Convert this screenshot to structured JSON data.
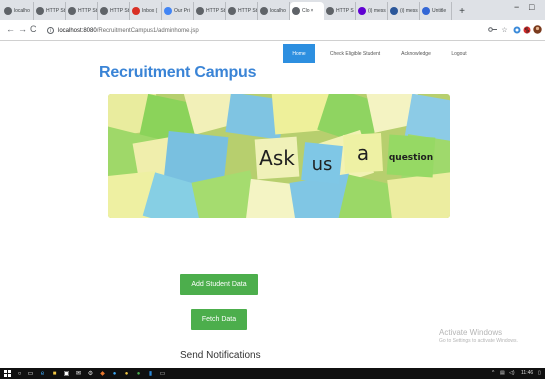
{
  "browser": {
    "tabs": [
      {
        "label": "localho",
        "color": "#5f6368",
        "glyph": "icon-chrome"
      },
      {
        "label": "HTTP St",
        "color": "#5f6368",
        "glyph": "icon-chrome"
      },
      {
        "label": "HTTP St",
        "color": "#5f6368",
        "glyph": "icon-chrome"
      },
      {
        "label": "HTTP St",
        "color": "#5f6368",
        "glyph": "icon-chrome"
      },
      {
        "label": "Inbox (",
        "color": "#d93025",
        "glyph": "gmail-icon"
      },
      {
        "label": "Our Pri",
        "color": "#4285f4",
        "glyph": "google-icon"
      },
      {
        "label": "HTTP St",
        "color": "#5f6368",
        "glyph": "icon-chrome"
      },
      {
        "label": "HTTP St",
        "color": "#5f6368",
        "glyph": "icon-chrome"
      },
      {
        "label": "localho",
        "color": "#5f6368",
        "glyph": "icon-chrome"
      },
      {
        "label": "Clo",
        "color": "#5f6368",
        "glyph": "icon-chrome",
        "active": true
      },
      {
        "label": "HTTP S",
        "color": "#5f6368",
        "glyph": "icon-chrome"
      },
      {
        "label": "(i) mess",
        "color": "#6001d2",
        "glyph": "yahoo-icon"
      },
      {
        "label": "(i) mess",
        "color": "#2b579a",
        "glyph": "doc-icon"
      },
      {
        "label": "Untitle",
        "color": "#3367d6",
        "glyph": "doc-icon"
      }
    ],
    "new_tab": "+",
    "minimize": "−",
    "maximize": "□",
    "url_host": "localhost:8080",
    "url_path": "/RecruitmentCampus1/adminhome.jsp"
  },
  "nav": {
    "items": [
      {
        "label": "Home",
        "active": true
      },
      {
        "label": "Check Eligible Student",
        "active": false
      },
      {
        "label": "Acknowledge",
        "active": false
      },
      {
        "label": "Logout",
        "active": false
      }
    ]
  },
  "site_title": "Recruitment Campus",
  "banner": {
    "words": [
      "Ask",
      "us",
      "a",
      "question"
    ]
  },
  "actions": {
    "add_student": "Add Student Data",
    "fetch": "Fetch Data"
  },
  "send_notifications": "Send Notifications",
  "watermark": {
    "line1": "Activate Windows",
    "line2": "Go to Settings to activate Windows."
  },
  "tray": {
    "time": "11:46"
  },
  "colors": {
    "accent_blue": "#2d8fe0",
    "title_blue": "#3a84d6",
    "button_green": "#4cae4c"
  }
}
